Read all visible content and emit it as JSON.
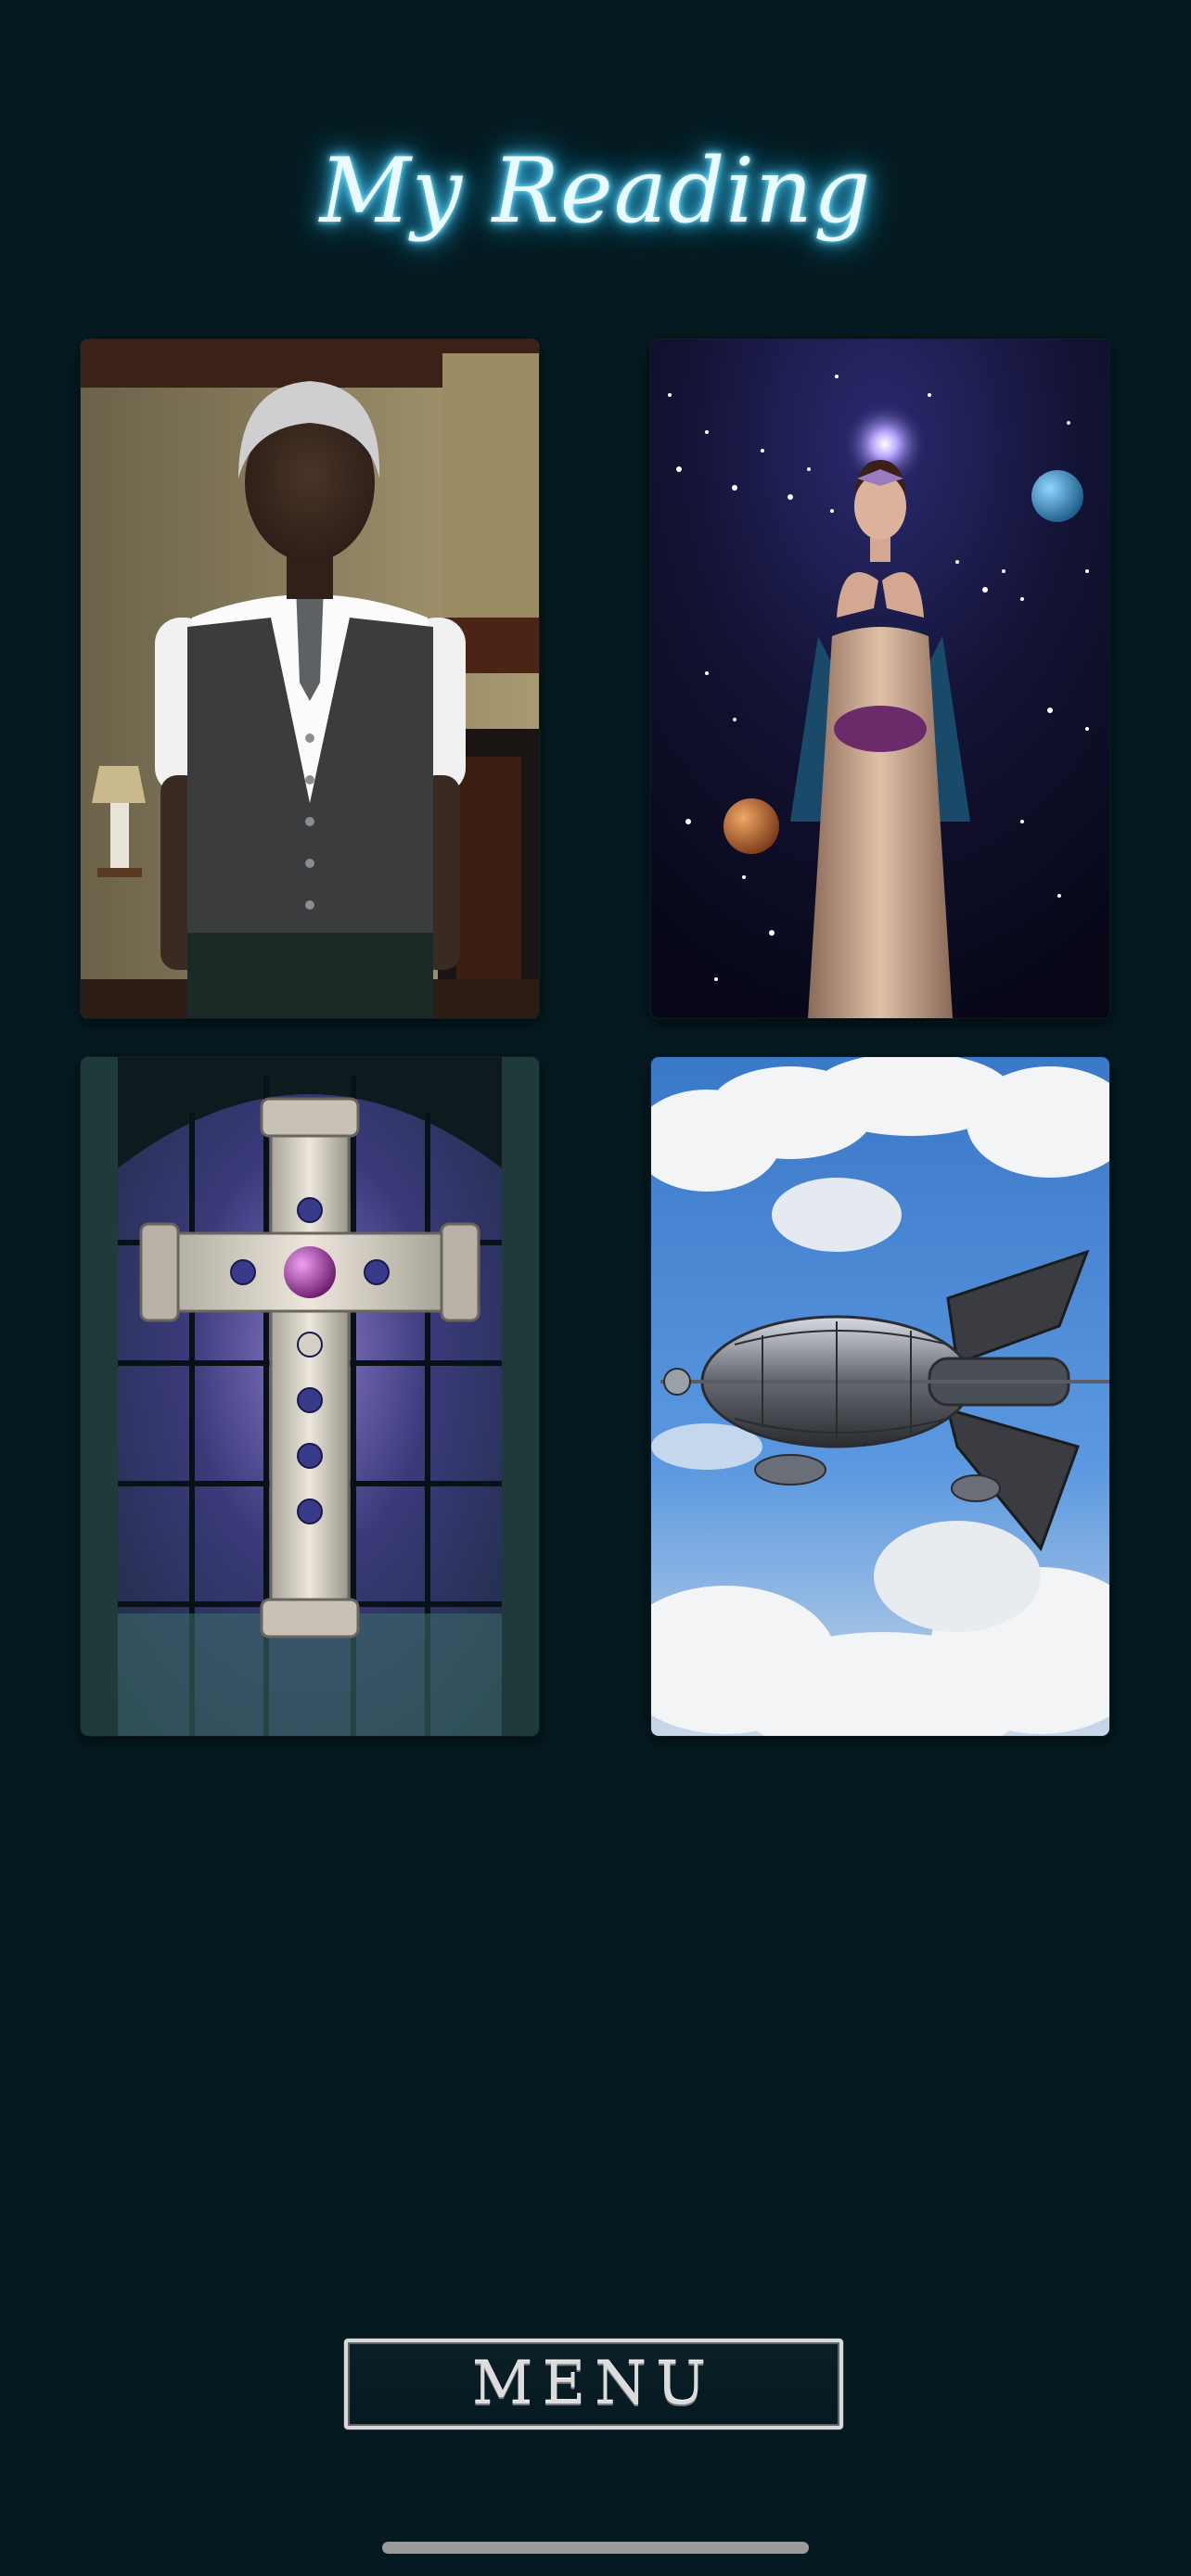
{
  "header": {
    "title": "My Reading"
  },
  "cards": [
    {
      "name": "card-1",
      "subject": "gentleman-in-vest"
    },
    {
      "name": "card-2",
      "subject": "star-woman"
    },
    {
      "name": "card-3",
      "subject": "jeweled-cross"
    },
    {
      "name": "card-4",
      "subject": "airship"
    }
  ],
  "footer": {
    "menu_label": "MENU"
  },
  "colors": {
    "background": "#051a20",
    "title_glow": "#5fd6ff",
    "menu_border": "#d9d9d9"
  }
}
